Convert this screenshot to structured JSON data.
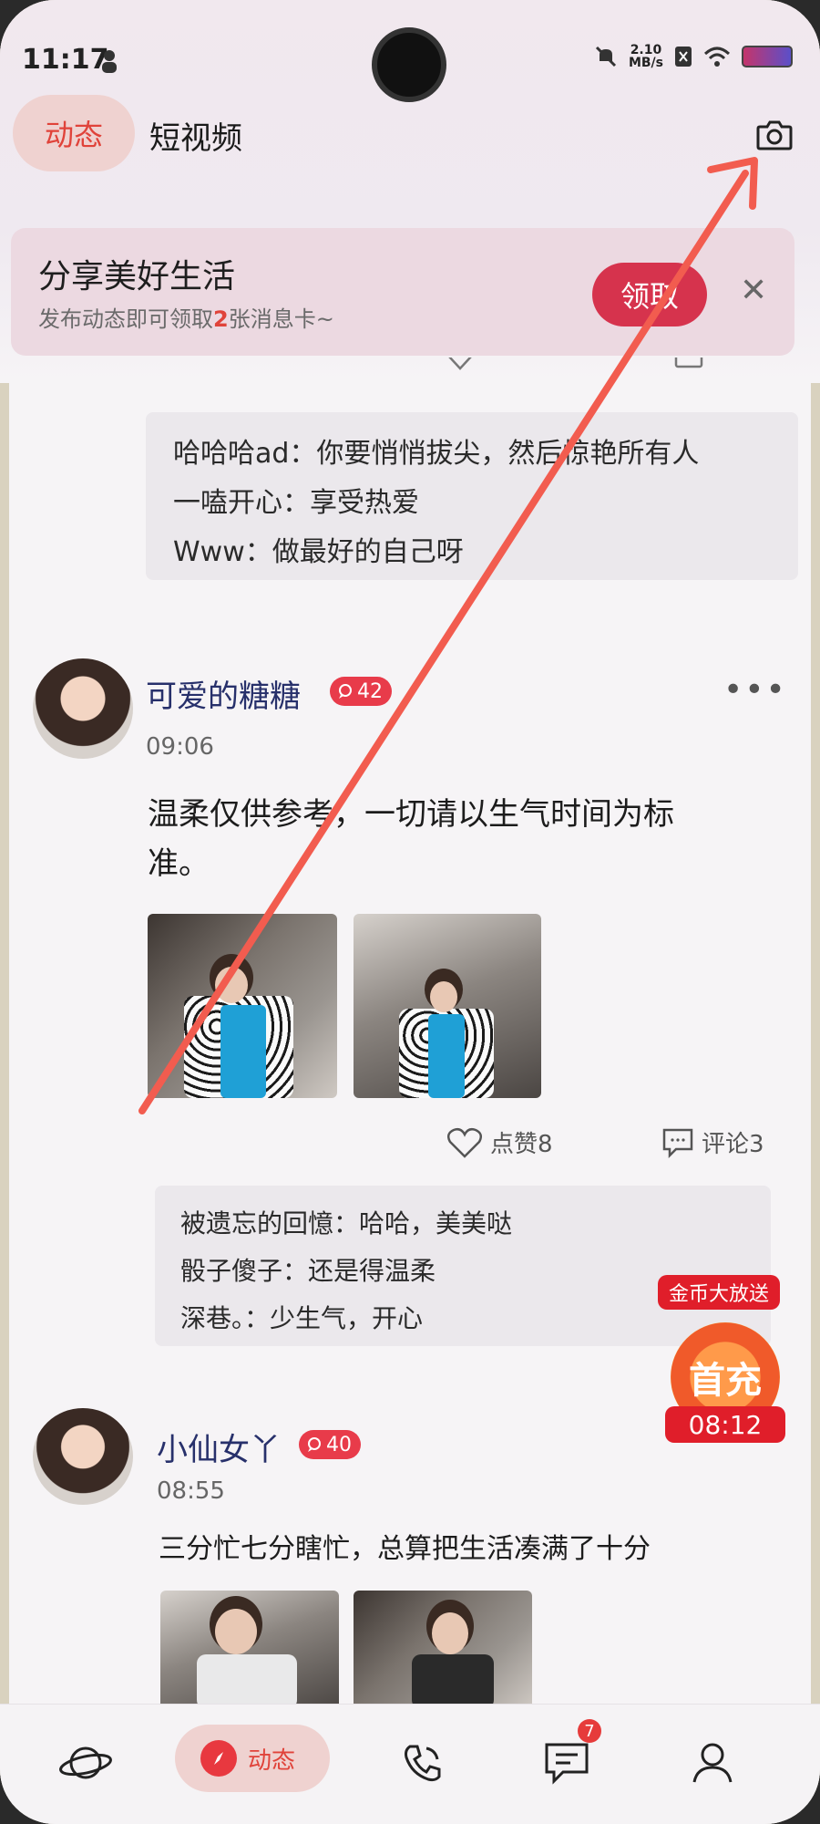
{
  "status_bar": {
    "time": "11:17",
    "net_speed_value": "2.10",
    "net_speed_unit": "MB/s"
  },
  "top_nav": {
    "tabs": [
      {
        "label": "动态",
        "active": true
      },
      {
        "label": "短视频",
        "active": false
      }
    ],
    "camera_icon": "camera-icon"
  },
  "banner": {
    "title": "分享美好生活",
    "subtitle_prefix": "发布动态即可领取",
    "subtitle_highlight": "2",
    "subtitle_suffix": "张消息卡~",
    "button_label": "领取",
    "close_glyph": "✕"
  },
  "previous_post": {
    "comments": [
      "哈哈哈ad：你要悄悄拔尖，然后惊艳所有人",
      "一嗑开心：享受热爱",
      "Www：做最好的自己呀"
    ]
  },
  "posts": [
    {
      "username": "可爱的糖糖",
      "badge": "42",
      "time": "09:06",
      "text_line1": "温柔仅供参考，一切请以生气时间为标",
      "text_line2": "准。",
      "like_label": "点赞8",
      "comment_label": "评论3",
      "comments": [
        "被遗忘的回憶：哈哈，美美哒",
        "骰子傻子：还是得温柔",
        "深巷。：少生气，开心"
      ]
    },
    {
      "username": "小仙女丫",
      "badge": "40",
      "time": "08:55",
      "text_line1": "三分忙七分瞎忙，总算把生活凑满了十分"
    }
  ],
  "promo": {
    "tag": "金币大放送",
    "coin_text": "首充",
    "timer": "08:12"
  },
  "bottom_nav": {
    "items": [
      {
        "icon": "planet-icon"
      },
      {
        "icon": "compass-icon",
        "label": "动态",
        "active": true
      },
      {
        "icon": "phone-call-icon"
      },
      {
        "icon": "message-icon",
        "badge": "7"
      },
      {
        "icon": "profile-icon"
      }
    ]
  },
  "colors": {
    "accent": "#e0433a",
    "annotation_arrow": "#f25c4f"
  }
}
